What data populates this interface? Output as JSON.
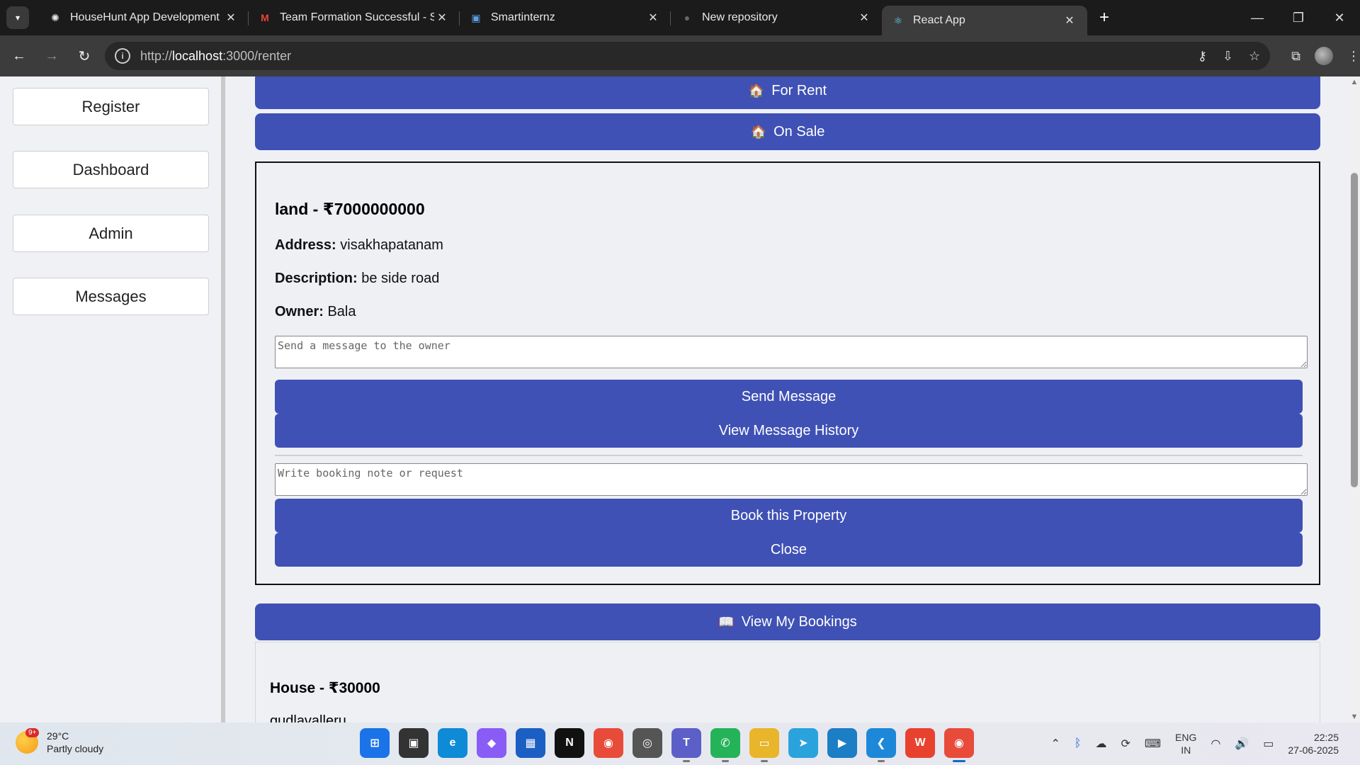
{
  "browser": {
    "tabs": [
      {
        "title": "HouseHunt App Development",
        "icon": "chatgpt-icon",
        "active": false
      },
      {
        "title": "Team Formation Successful - Sm",
        "icon": "gmail-icon",
        "active": false
      },
      {
        "title": "Smartinternz",
        "icon": "smartinternz-icon",
        "active": false
      },
      {
        "title": "New repository",
        "icon": "github-icon",
        "active": false
      },
      {
        "title": "React App",
        "icon": "react-icon",
        "active": true
      }
    ],
    "url_prefix": "http://",
    "url_host": "localhost",
    "url_rest": ":3000/renter"
  },
  "sidebar": {
    "items": [
      {
        "label": "Register"
      },
      {
        "label": "Dashboard"
      },
      {
        "label": "Admin"
      },
      {
        "label": "Messages"
      }
    ]
  },
  "main": {
    "for_rent": {
      "emoji": "🏠",
      "label": "For Rent"
    },
    "on_sale": {
      "emoji": "🏠",
      "label": "On Sale"
    },
    "property": {
      "title": "land - ₹7000000000",
      "address_label": "Address:",
      "address": "visakhapatanam",
      "description_label": "Description:",
      "description": "be side road",
      "owner_label": "Owner:",
      "owner": "Bala",
      "message_placeholder": "Send a message to the owner",
      "send_label": "Send Message",
      "history_label": "View Message History",
      "booking_placeholder": "Write booking note or request",
      "book_label": "Book this Property",
      "close_label": "Close"
    },
    "bookings_button": {
      "emoji": "📖",
      "label": "View My Bookings"
    },
    "booking_card": {
      "title": "House - ₹30000",
      "location": "gudlavalleru"
    }
  },
  "taskbar": {
    "weather": {
      "temp": "29°C",
      "condition": "Partly cloudy",
      "badge": "9+"
    },
    "apps": [
      {
        "name": "windows-start-icon",
        "color": "#1a73e8",
        "glyph": "⊞"
      },
      {
        "name": "task-view-icon",
        "color": "#333333",
        "glyph": "▣"
      },
      {
        "name": "edge-icon",
        "color": "#0f8ad6",
        "glyph": "e"
      },
      {
        "name": "copilot-icon",
        "color": "#8a5cf6",
        "glyph": "◆"
      },
      {
        "name": "store-icon",
        "color": "#1c5fc4",
        "glyph": "▦"
      },
      {
        "name": "netflix-icon",
        "color": "#111111",
        "glyph": "N"
      },
      {
        "name": "chrome-icon",
        "color": "#e84b3a",
        "glyph": "◉"
      },
      {
        "name": "camera-icon",
        "color": "#555555",
        "glyph": "◎"
      },
      {
        "name": "teams-icon",
        "color": "#5b5fc7",
        "glyph": "T"
      },
      {
        "name": "whatsapp-icon",
        "color": "#25b35a",
        "glyph": "✆"
      },
      {
        "name": "file-explorer-icon",
        "color": "#e8b52b",
        "glyph": "▭"
      },
      {
        "name": "telegram-icon",
        "color": "#2aa3dd",
        "glyph": "➤"
      },
      {
        "name": "prime-video-icon",
        "color": "#1c7ec4",
        "glyph": "▶"
      },
      {
        "name": "vscode-icon",
        "color": "#1e88d8",
        "glyph": "❮"
      },
      {
        "name": "wps-office-icon",
        "color": "#e8422f",
        "glyph": "W"
      },
      {
        "name": "chrome-active-icon",
        "color": "#e84b3a",
        "glyph": "◉"
      }
    ],
    "lang": {
      "line1": "ENG",
      "line2": "IN"
    },
    "time": "22:25",
    "date": "27-06-2025"
  }
}
